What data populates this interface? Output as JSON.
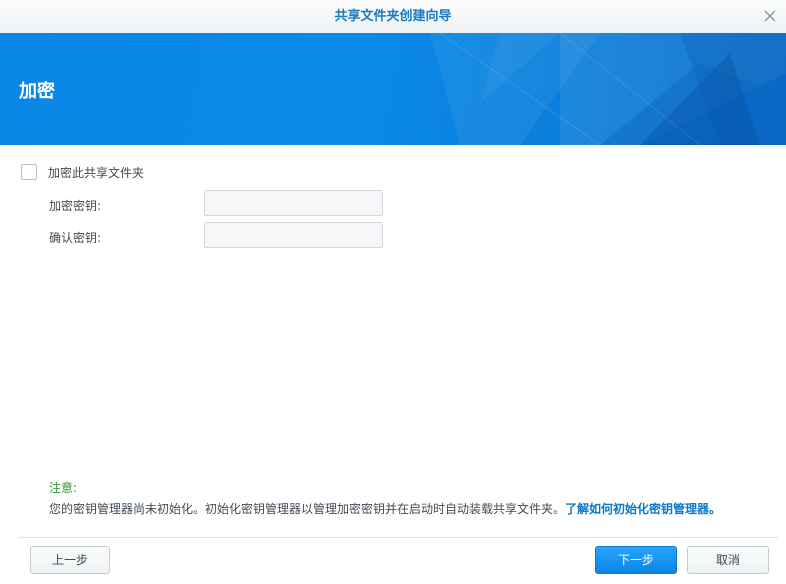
{
  "window": {
    "title": "共享文件夹创建向导"
  },
  "banner": {
    "heading": "加密"
  },
  "form": {
    "encrypt_checkbox_label": "加密此共享文件夹",
    "encrypt_checked": false,
    "key_label": "加密密钥:",
    "key_value": "",
    "confirm_label": "确认密钥:",
    "confirm_value": ""
  },
  "note": {
    "title": "注意:",
    "text": "您的密钥管理器尚未初始化。初始化密钥管理器以管理加密密钥并在启动时自动装载共享文件夹。",
    "link": "了解如何初始化密钥管理器。"
  },
  "footer": {
    "back_label": "上一步",
    "next_label": "下一步",
    "cancel_label": "取消"
  },
  "colors": {
    "title": "#1a7bc1",
    "banner": "#0a86e6",
    "note_title": "#2d9a2d",
    "link": "#0b78c8",
    "primary_button": "#0a86e6"
  },
  "icons": {
    "close": "close-icon"
  }
}
